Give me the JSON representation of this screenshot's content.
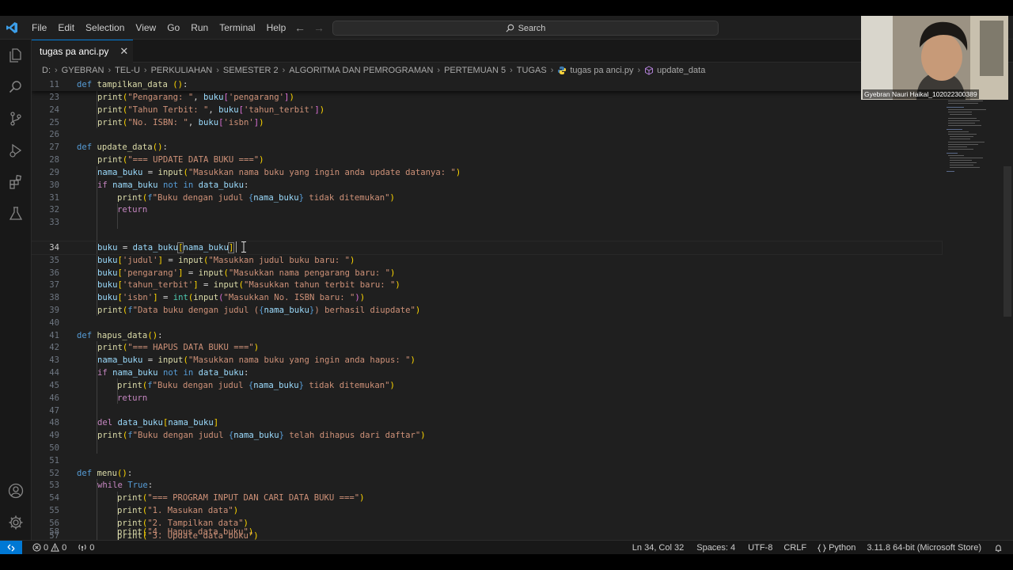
{
  "menu": [
    "File",
    "Edit",
    "Selection",
    "View",
    "Go",
    "Run",
    "Terminal",
    "Help"
  ],
  "search": {
    "placeholder": "Search"
  },
  "tab": {
    "label": "tugas pa anci.py"
  },
  "breadcrumb": [
    "D:",
    "GYEBRAN",
    "TEL-U",
    "PERKULIAHAN",
    "SEMESTER 2",
    "ALGORITMA DAN PEMROGRAMAN",
    "PERTEMUAN 5",
    "TUGAS",
    "tugas pa anci.py",
    "update_data"
  ],
  "editor": {
    "sticky_line": {
      "num": "11",
      "text": "def tampilkan_data ():"
    },
    "line_numbers": [
      "23",
      "24",
      "25",
      "26",
      "27",
      "28",
      "29",
      "30",
      "31",
      "32",
      "33",
      "34",
      "35",
      "36",
      "37",
      "38",
      "39",
      "40",
      "41",
      "42",
      "43",
      "44",
      "45",
      "46",
      "47",
      "48",
      "49",
      "50",
      "51",
      "52",
      "53",
      "54",
      "55",
      "56",
      "57",
      "58"
    ],
    "active_line": "34"
  },
  "webcam": {
    "name": "Gyebran Nauri Haikal_102022300389"
  },
  "status": {
    "errors": "0",
    "warnings": "0",
    "ports": "0",
    "position": "Ln 34, Col 32",
    "spaces": "Spaces: 4",
    "encoding": "UTF-8",
    "eol": "CRLF",
    "language": "Python",
    "interpreter": "3.11.8 64-bit (Microsoft Store)"
  },
  "colors": {
    "accent": "#0078d4",
    "editor_bg": "#1f1f1f",
    "keyword": "#569cd6",
    "function": "#dcdcaa",
    "string": "#ce9178",
    "variable": "#9cdcfe"
  }
}
